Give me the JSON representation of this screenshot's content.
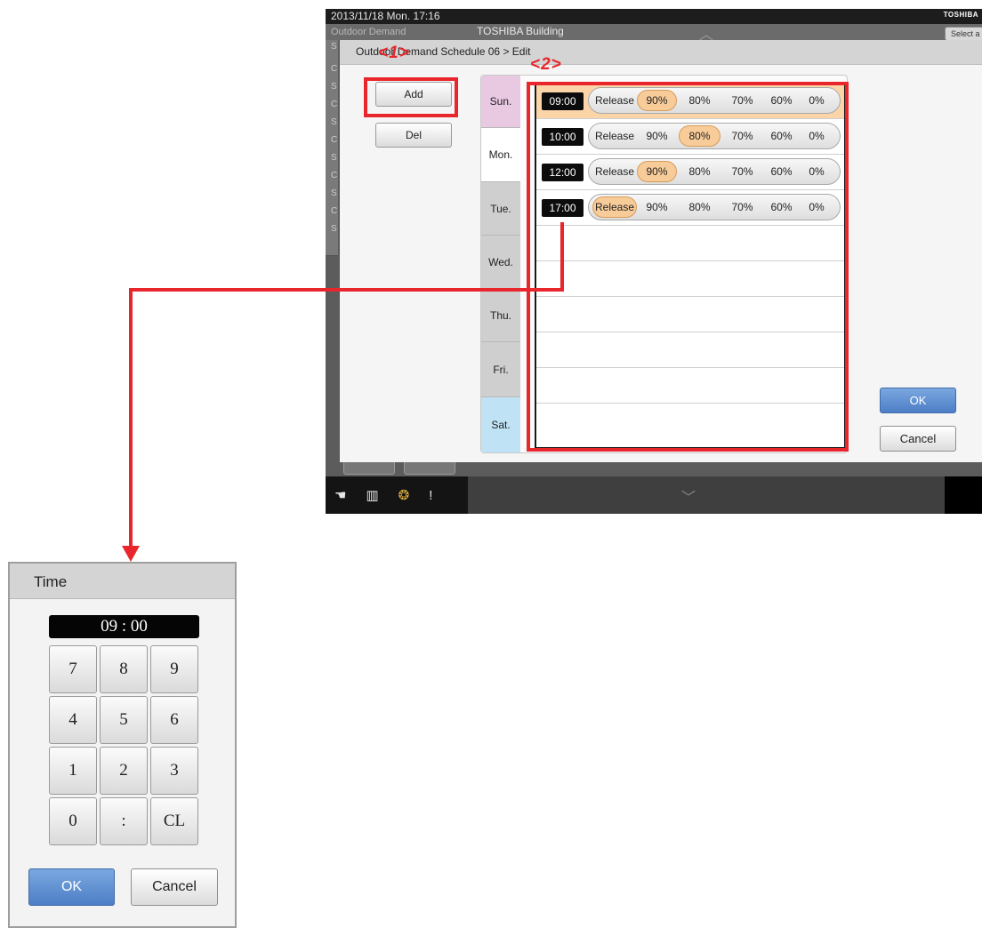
{
  "status_bar": {
    "datetime": "2013/11/18  Mon.  17:16",
    "brand": "TOSHIBA"
  },
  "header": {
    "left_title": "Outdoor Demand",
    "building": "TOSHIBA Building",
    "select_label": "Select a"
  },
  "background_rows": [
    "S",
    "C",
    "S",
    "C",
    "S",
    "C",
    "S",
    "C",
    "S",
    "C",
    "S"
  ],
  "dialog": {
    "breadcrumb": "Outdoor Demand Schedule 06 > Edit",
    "add_label": "Add",
    "del_label": "Del",
    "ok_label": "OK",
    "cancel_label": "Cancel"
  },
  "days": [
    {
      "label": "Sun.",
      "color": "#e9c8e2"
    },
    {
      "label": "Mon.",
      "color": "#ffffff"
    },
    {
      "label": "Tue.",
      "color": "#cfcfcf"
    },
    {
      "label": "Wed.",
      "color": "#cfcfcf"
    },
    {
      "label": "Thu.",
      "color": "#cfcfcf"
    },
    {
      "label": "Fri.",
      "color": "#cfcfcf"
    },
    {
      "label": "Sat.",
      "color": "#bfe3f5"
    }
  ],
  "options": [
    "Release",
    "90%",
    "80%",
    "70%",
    "60%",
    "0%"
  ],
  "schedule": [
    {
      "time": "09:00",
      "selected": "90%"
    },
    {
      "time": "10:00",
      "selected": "80%"
    },
    {
      "time": "12:00",
      "selected": "90%"
    },
    {
      "time": "17:00",
      "selected": "Release"
    }
  ],
  "annotations": {
    "callout1": "<1>",
    "callout2": "<2>"
  },
  "time_dialog": {
    "title": "Time",
    "value": "09 : 00",
    "keys": [
      "7",
      "8",
      "9",
      "4",
      "5",
      "6",
      "1",
      "2",
      "3",
      "0",
      ":",
      "CL"
    ],
    "ok_label": "OK",
    "cancel_label": "Cancel"
  },
  "colors": {
    "accent_red": "#e8262b",
    "selected_option": "#f8cc99",
    "ok_blue": "#5b8bd0",
    "selected_row": "#fbd5a8"
  },
  "icons": [
    "hand-pointer-icon",
    "book-icon",
    "circle-progress-icon",
    "alert-icon",
    "chevron-up-icon",
    "chevron-down-icon"
  ]
}
